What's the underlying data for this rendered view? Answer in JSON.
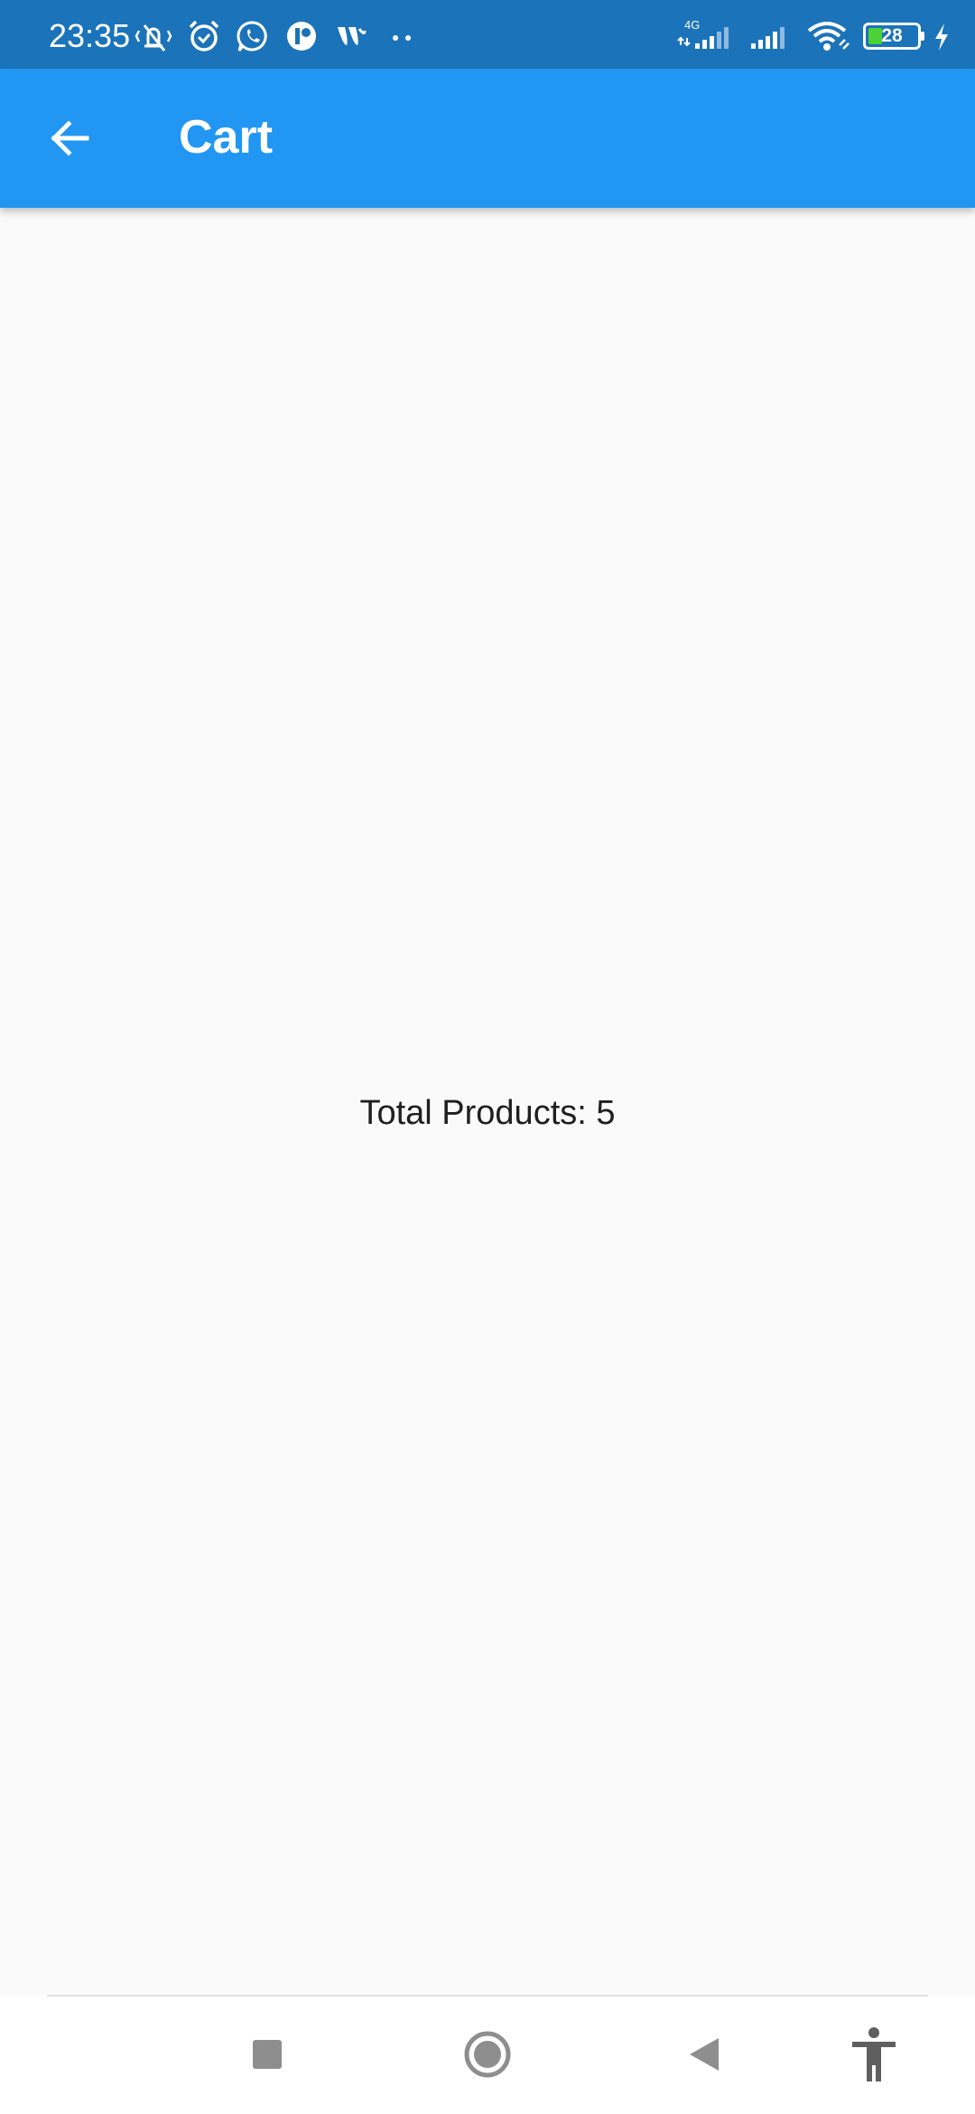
{
  "status_bar": {
    "time": "23:35",
    "network_type": "4G",
    "battery_level": "28",
    "battery_percent": 28,
    "left_icons": [
      "vibrate-silent-icon",
      "alarm-icon",
      "whatsapp-icon",
      "app-notification-icon",
      "wireless-icon",
      "more-dots-icon"
    ],
    "right_icons": [
      "signal-4g-icon",
      "signal-icon",
      "wifi-icon",
      "battery-icon",
      "charging-icon"
    ]
  },
  "app_bar": {
    "title": "Cart",
    "background": "#2196f3"
  },
  "content": {
    "total_products_text": "Total Products: 5"
  },
  "nav_bar": {
    "buttons": [
      "recent-apps",
      "home",
      "back",
      "accessibility"
    ]
  }
}
